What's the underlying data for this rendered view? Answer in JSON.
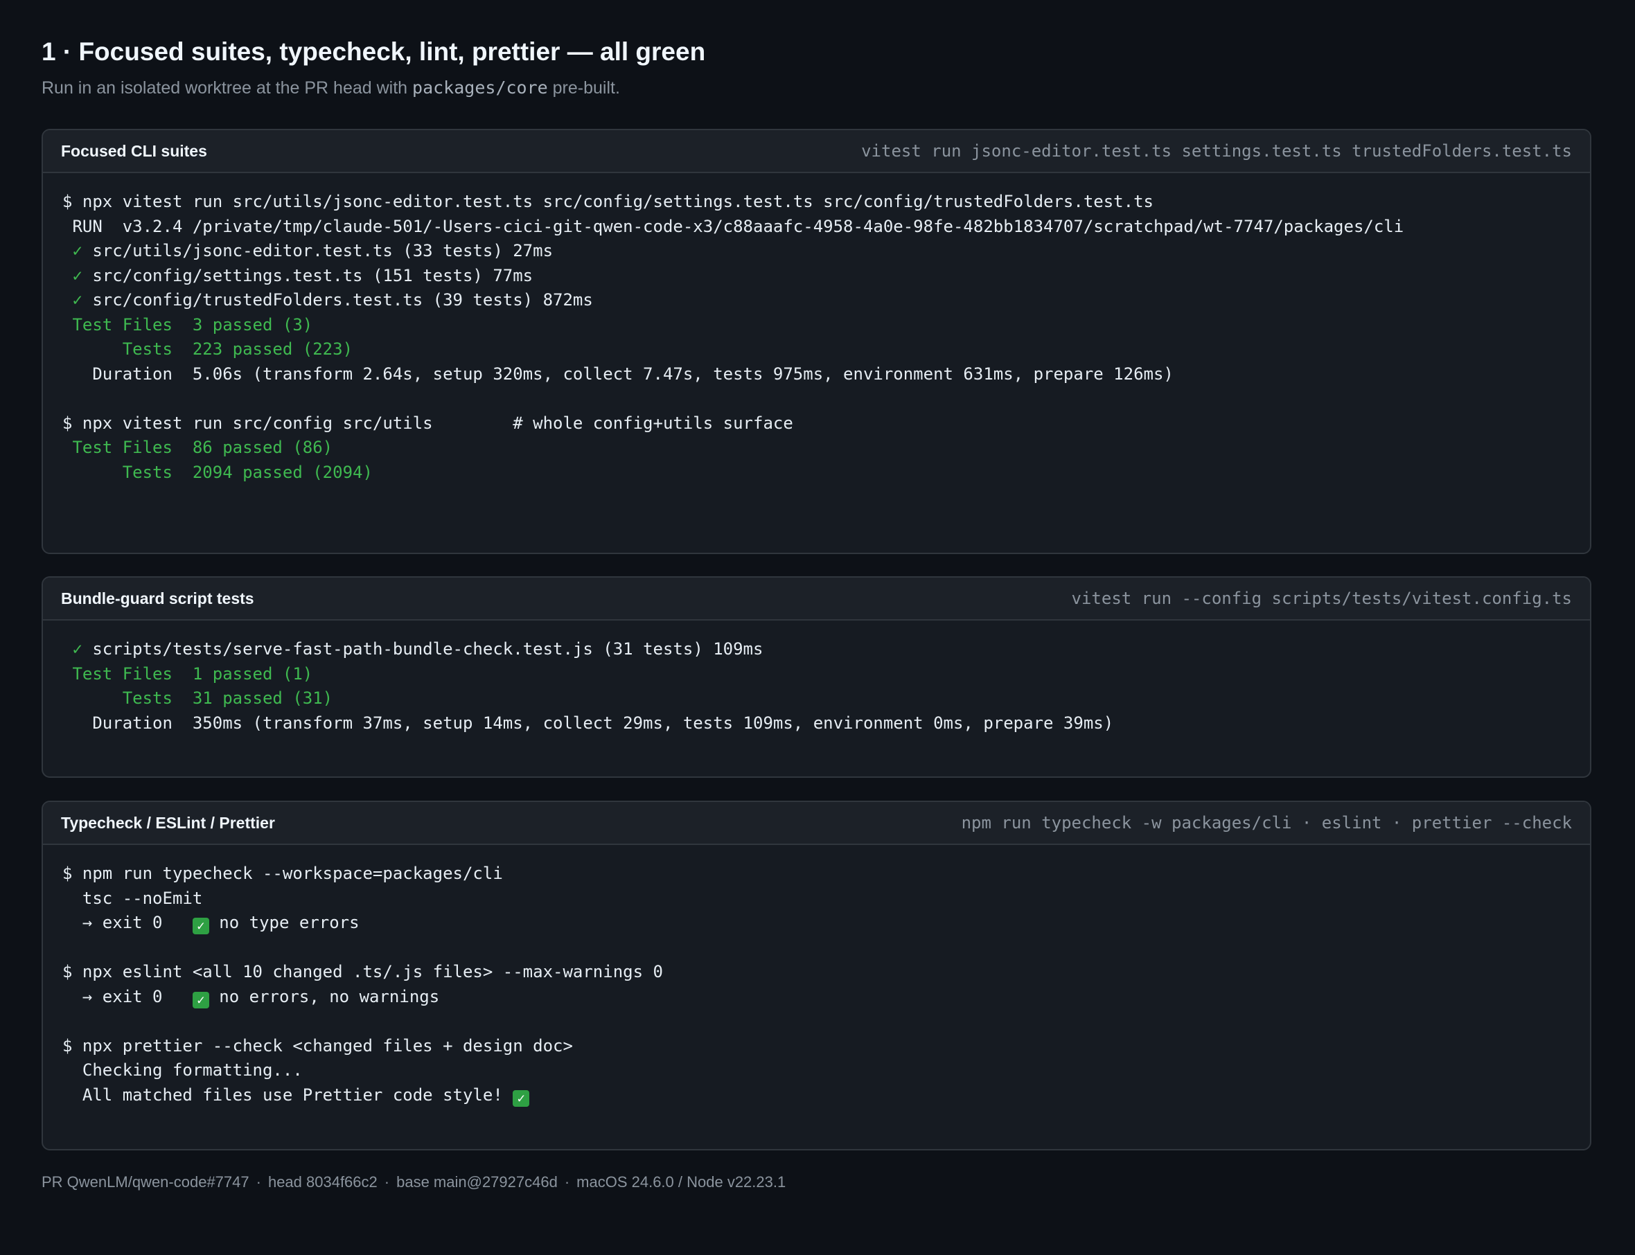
{
  "header": {
    "title": "1 · Focused suites, typecheck, lint, prettier — all green",
    "subtitle_pre": "Run in an isolated worktree at the PR head with ",
    "subtitle_code": "packages/core",
    "subtitle_post": " pre-built."
  },
  "panels": [
    {
      "title": "Focused CLI suites",
      "command": "vitest run jsonc-editor.test.ts settings.test.ts trustedFolders.test.ts",
      "lines": [
        "$ npx vitest run src/utils/jsonc-editor.test.ts src/config/settings.test.ts src/config/trustedFolders.test.ts",
        " RUN  v3.2.4 /private/tmp/claude-501/-Users-cici-git-qwen-code-x3/c88aaafc-4958-4a0e-98fe-482bb1834707/scratchpad/wt-7747/packages/cli",
        "src/utils/jsonc-editor.test.ts (33 tests) 27ms",
        "src/config/settings.test.ts (151 tests) 77ms",
        "src/config/trustedFolders.test.ts (39 tests) 872ms",
        " Test Files  3 passed (3)",
        "      Tests  223 passed (223)",
        "   Duration  5.06s (transform 2.64s, setup 320ms, collect 7.47s, tests 975ms, environment 631ms, prepare 126ms)",
        "$ npx vitest run src/config src/utils        # whole config+utils surface",
        " Test Files  86 passed (86)",
        "      Tests  2094 passed (2094)"
      ]
    },
    {
      "title": "Bundle-guard script tests",
      "command": "vitest run --config scripts/tests/vitest.config.ts",
      "lines": [
        "scripts/tests/serve-fast-path-bundle-check.test.js (31 tests) 109ms",
        " Test Files  1 passed (1)",
        "      Tests  31 passed (31)",
        "   Duration  350ms (transform 37ms, setup 14ms, collect 29ms, tests 109ms, environment 0ms, prepare 39ms)"
      ]
    },
    {
      "title": "Typecheck / ESLint / Prettier",
      "command": "npm run typecheck -w packages/cli · eslint · prettier --check",
      "lines": [
        "$ npm run typecheck --workspace=packages/cli",
        "  tsc --noEmit",
        "  → exit 0   ",
        " no type errors",
        "$ npx eslint <all 10 changed .ts/.js files> --max-warnings 0",
        "  → exit 0   ",
        " no errors, no warnings",
        "$ npx prettier --check <changed files + design doc>",
        "  Checking formatting...",
        "  All matched files use Prettier code style! "
      ]
    }
  ],
  "symbols": {
    "check": "✓",
    "check_box": "✓"
  },
  "footer": {
    "pr": "PR QwenLM/qwen-code#7747",
    "head": "head 8034f66c2",
    "base": "base main@27927c46d",
    "env": "macOS 24.6.0 / Node v22.23.1",
    "separator": "·"
  },
  "colors": {
    "background": "#0d1117",
    "panel": "#161b22",
    "border": "#30363d",
    "pass_green": "#3fb950",
    "check_box_green": "#2ea043"
  }
}
